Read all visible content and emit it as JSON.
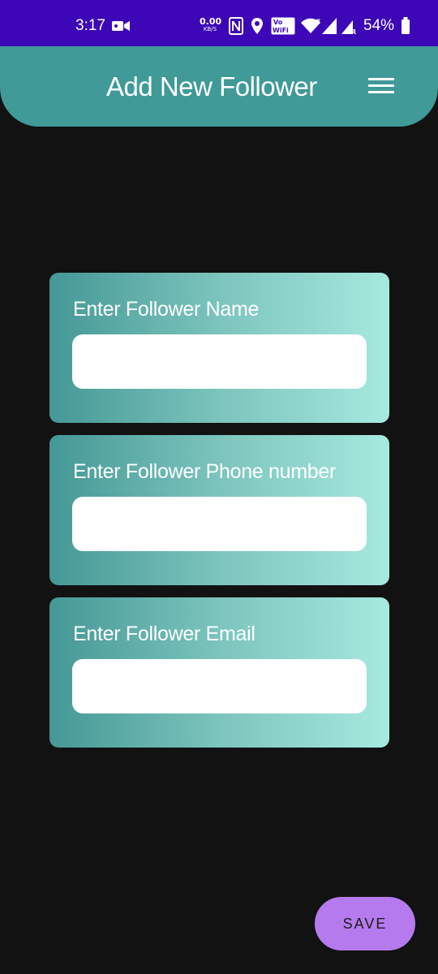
{
  "status_bar": {
    "time": "3:17",
    "net_speed_value": "0.00",
    "net_speed_unit": "KB/S",
    "battery_percent": "54%",
    "icons": [
      "video-camera-icon",
      "nfc-icon",
      "location-icon",
      "vowifi-icon",
      "wifi-icon",
      "signal-icon",
      "signal-roaming-icon",
      "battery-icon"
    ],
    "vowifi_label": "Vo WiFi"
  },
  "header": {
    "title": "Add New Follower",
    "menu_icon": "hamburger-menu-icon",
    "color": "#3f9a98"
  },
  "form": {
    "name_label": "Enter Follower Name",
    "name_value": "",
    "phone_label": "Enter Follower Phone number",
    "phone_value": "",
    "email_label": "Enter Follower Email",
    "email_value": ""
  },
  "save_button": {
    "label": "SAVE",
    "color": "#b57bee"
  },
  "colors": {
    "status_bar": "#3d06b6",
    "background": "#121212",
    "card_gradient_start": "#459896",
    "card_gradient_end": "#a6e9df"
  }
}
